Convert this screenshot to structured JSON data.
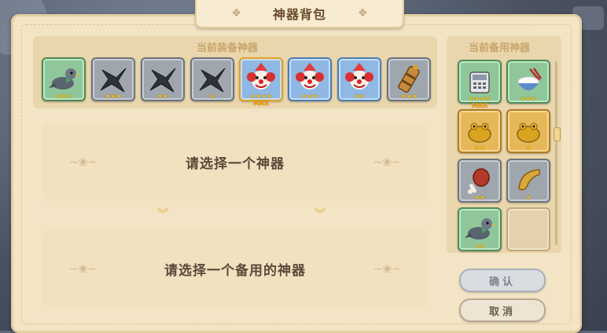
{
  "title": "神器背包",
  "equipped": {
    "label": "当前装备神器",
    "items": [
      {
        "icon": "pigeon-icon",
        "stars": "★★★",
        "frame": "green"
      },
      {
        "icon": "shuriken-icon",
        "stars": "★★★",
        "frame": "gray"
      },
      {
        "icon": "shuriken-icon",
        "stars": "★★",
        "frame": "gray"
      },
      {
        "icon": "shuriken-icon",
        "stars": "★",
        "frame": "gray"
      },
      {
        "icon": "clown-icon",
        "stars": "★★★★",
        "frame": "blue",
        "max": "MAX"
      },
      {
        "icon": "clown-icon",
        "stars": "★★★",
        "frame": "blue"
      },
      {
        "icon": "clown-icon",
        "stars": "★★",
        "frame": "blue"
      },
      {
        "icon": "bamboo-tube-icon",
        "stars": "★★★",
        "frame": "gray"
      }
    ]
  },
  "select_equipped_text": "请选择一个神器",
  "select_backup_text": "请选择一个备用的神器",
  "backup": {
    "label": "当前备用神器",
    "items": [
      {
        "icon": "phone-icon",
        "stars": "★★★★",
        "frame": "green",
        "max": "MAX"
      },
      {
        "icon": "rice-bowl-icon",
        "stars": "★★★",
        "frame": "green"
      },
      {
        "icon": "golden-toad-icon",
        "stars": "★★",
        "frame": "gold"
      },
      {
        "icon": "golden-toad-icon",
        "stars": "★",
        "frame": "gold"
      },
      {
        "icon": "meat-icon",
        "stars": "★★",
        "frame": "gray"
      },
      {
        "icon": "croissant-icon",
        "stars": "★",
        "frame": "gray"
      },
      {
        "icon": "pigeon-icon",
        "stars": "★★",
        "frame": "green"
      },
      {
        "icon": "empty-slot",
        "stars": "",
        "frame": "empty"
      }
    ]
  },
  "buttons": {
    "confirm": "确认",
    "cancel": "取消"
  },
  "colors": {
    "panel": "#f2e4c4",
    "gold_star": "#f4c21b",
    "title_text": "#6b4a2c"
  }
}
